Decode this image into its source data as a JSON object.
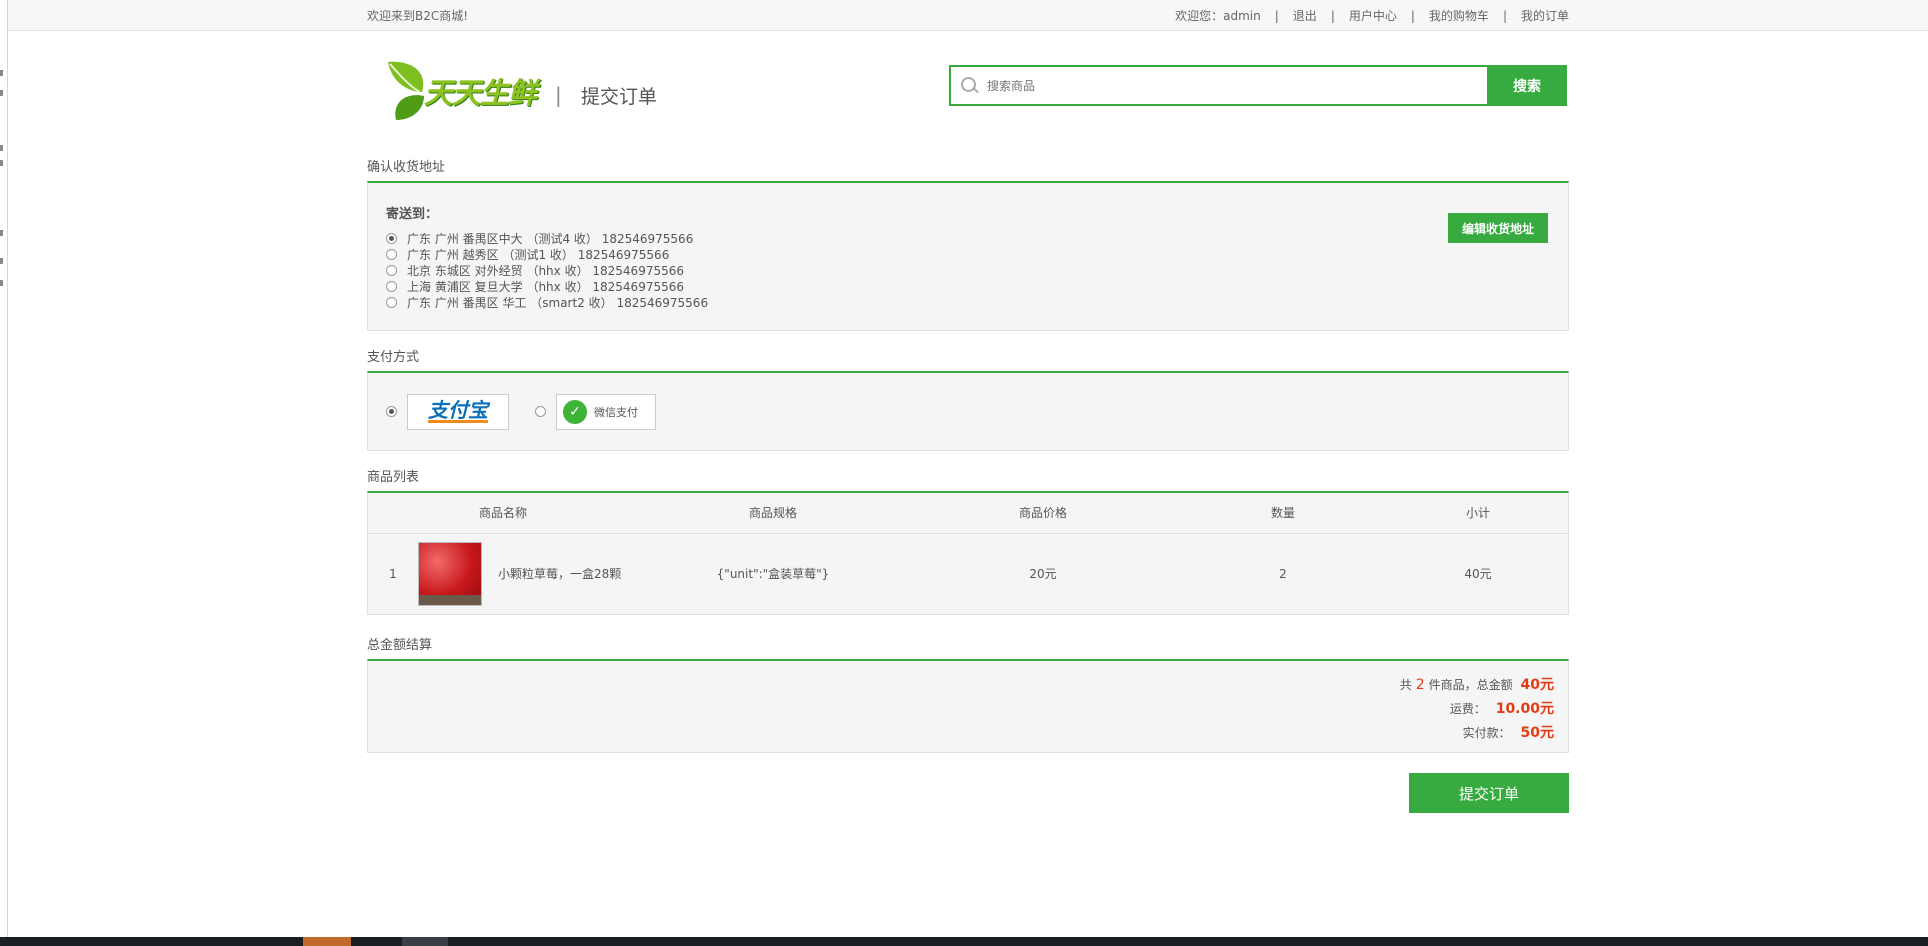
{
  "topbar": {
    "welcome": "欢迎来到B2C商城!",
    "greeting": "欢迎您：admin",
    "links": [
      "退出",
      "用户中心",
      "我的购物车",
      "我的订单"
    ]
  },
  "header": {
    "brand": "天天生鲜",
    "page_name": "提交订单",
    "search_placeholder": "搜索商品",
    "search_btn": "搜索"
  },
  "address": {
    "title": "确认收货地址",
    "label": "寄送到：",
    "items": [
      {
        "text": "广东 广州 番禺区中大 （测试4 收） 182546975566",
        "selected": true
      },
      {
        "text": "广东 广州 越秀区 （测试1 收） 182546975566",
        "selected": false
      },
      {
        "text": "北京 东城区 对外经贸 （hhx 收） 182546975566",
        "selected": false
      },
      {
        "text": "上海 黄浦区 复旦大学 （hhx 收） 182546975566",
        "selected": false
      },
      {
        "text": "广东 广州 番禺区 华工 （smart2 收） 182546975566",
        "selected": false
      }
    ],
    "edit_btn": "编辑收货地址"
  },
  "payment": {
    "title": "支付方式",
    "alipay": "支付宝",
    "wechat": "微信支付",
    "selected": "alipay"
  },
  "goods": {
    "title": "商品列表",
    "headers": [
      "商品名称",
      "商品规格",
      "商品价格",
      "数量",
      "小计"
    ],
    "rows": [
      {
        "index": "1",
        "name": "小颗粒草莓，一盒28颗",
        "spec": "{\"unit\":\"盒装草莓\"}",
        "price": "20元",
        "qty": "2",
        "subtotal": "40元"
      }
    ]
  },
  "total": {
    "title": "总金额结算",
    "count_pre": "共",
    "count": "2",
    "count_post": "件商品，总金额",
    "amount": "40元",
    "shipping_label": "运费：",
    "shipping": "10.00元",
    "paid_label": "实付款：",
    "paid": "50元"
  },
  "submit": "提交订单",
  "colors": {
    "accent": "#37ab40",
    "price": "#e23c14"
  }
}
